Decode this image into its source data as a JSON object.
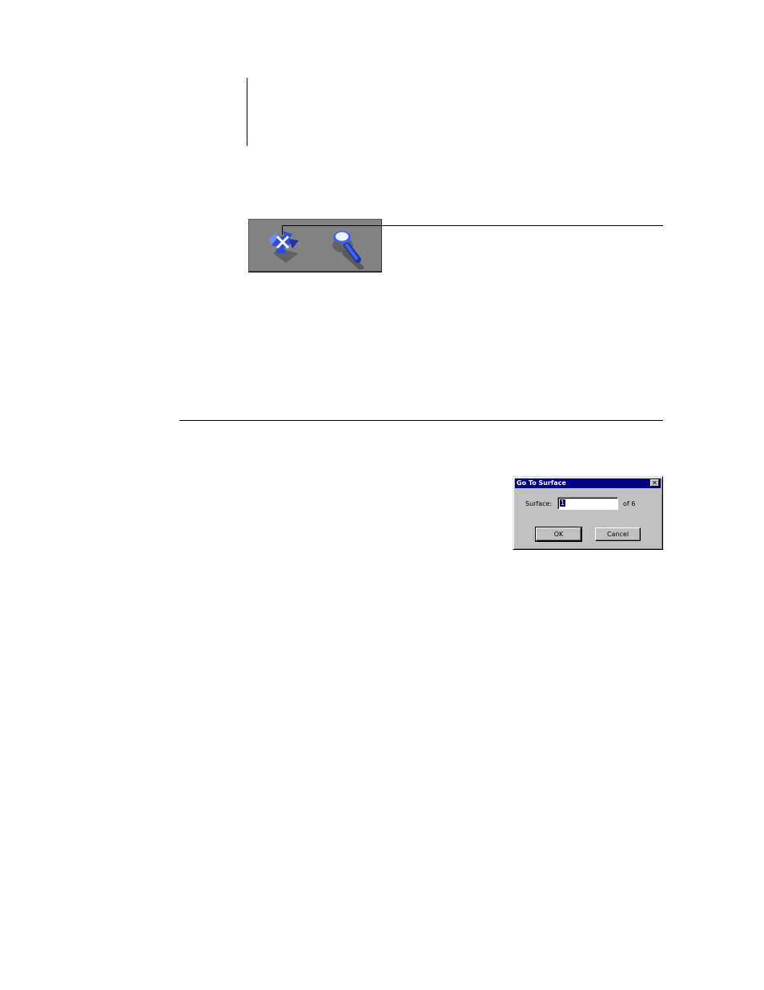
{
  "toolbar": {
    "icons": [
      "move-icon",
      "zoom-icon"
    ],
    "colors": {
      "panel": "#828282",
      "icon_blue": "#2f4fd8"
    }
  },
  "dialog": {
    "title": "Go To Surface",
    "close_glyph": "✕",
    "surface_label": "Surface:",
    "surface_value": "1",
    "of_count": "of 6",
    "ok_label": "OK",
    "cancel_label": "Cancel",
    "colors": {
      "title_bar": "#000080",
      "face": "#c0c0c0"
    }
  }
}
